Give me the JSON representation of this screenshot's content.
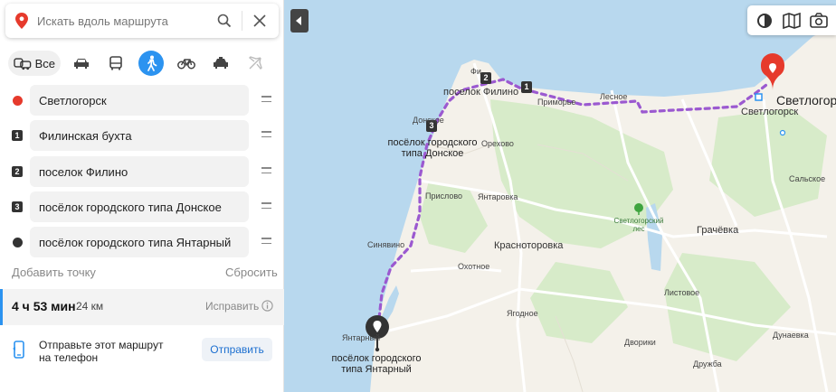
{
  "search": {
    "placeholder": "Искать вдоль маршрута"
  },
  "modes": {
    "all_label": "Все"
  },
  "points": [
    {
      "label": "Светлогорск",
      "marker": ""
    },
    {
      "label": "Филинская бухта",
      "marker": "1"
    },
    {
      "label": "поселок Филино",
      "marker": "2"
    },
    {
      "label": "посёлок городского типа Донское",
      "marker": "3"
    },
    {
      "label": "посёлок городского типа Янтарный",
      "marker": ""
    }
  ],
  "actions": {
    "add_point": "Добавить точку",
    "reset": "Сбросить"
  },
  "route": {
    "duration": "4 ч 53 мин",
    "distance": "24 км",
    "fix": "Исправить"
  },
  "send": {
    "text_line1": "Отправьте этот маршрут",
    "text_line2": "на телефон",
    "button": "Отправить"
  },
  "map_labels": {
    "filino": "Фи",
    "filino_full": "поселок Филино",
    "primorye": "Приморье",
    "lesnoe": "Лесное",
    "svetlogorsk": "Светлогорск",
    "svetlogorsk2": "Светлогорск",
    "donskoe_short": "Донское",
    "donskoe_line1": "посёлок городского",
    "donskoe_line2": "типа Донское",
    "orekhovo": "Орехово",
    "prislovo": "Прислово",
    "yantarovka": "Янтаровка",
    "sinyavino": "Синявино",
    "krasnotorovka": "Красноторовка",
    "okhotnoe": "Охотное",
    "forest_line1": "Светлогорский",
    "forest_line2": "лес",
    "grachevka": "Грачёвка",
    "salskoe": "Сальское",
    "listovoe": "Листовое",
    "yagodnoe": "Ягодное",
    "dvoriki": "Дворики",
    "dunaevka": "Дунаевка",
    "druzhba": "Дружба",
    "yantarny_short": "Янтарный",
    "yantarny_line1": "посёлок городского",
    "yantarny_line2": "типа Янтарный",
    "badge1": "1",
    "badge2": "2",
    "badge3": "3"
  },
  "colors": {
    "accent": "#2c93f0",
    "route": "#9b59d0",
    "start": "#e63a2c",
    "sea": "#b8d8ee",
    "land": "#f4f1ea",
    "forest": "#d7ebc9"
  }
}
